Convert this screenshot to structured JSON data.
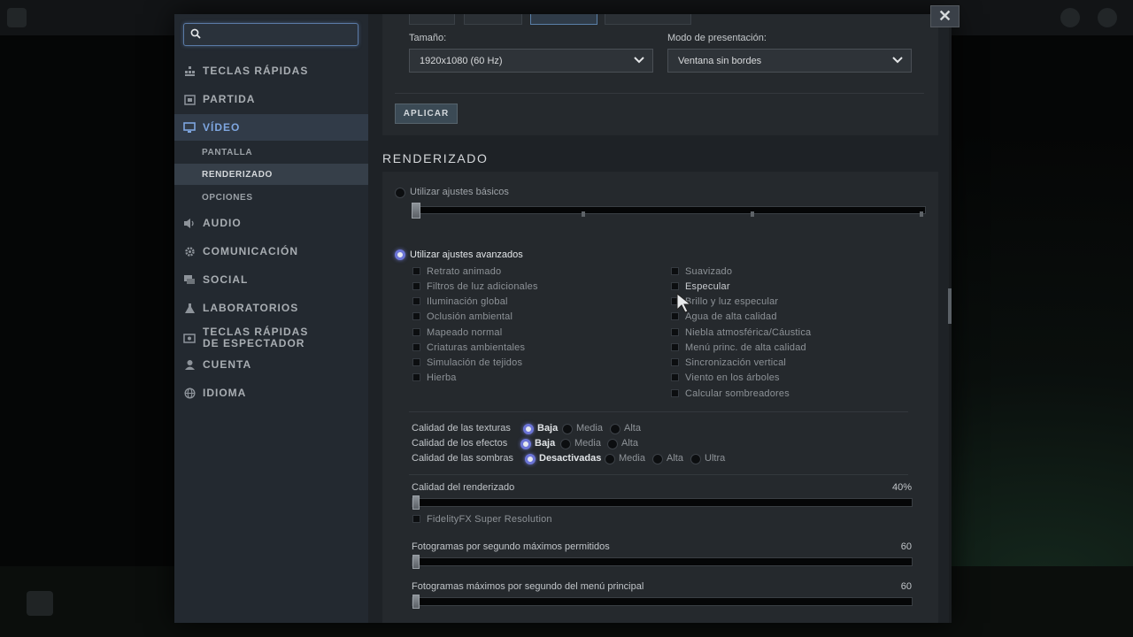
{
  "window": {
    "close_label": "✕"
  },
  "search": {
    "placeholder": "",
    "value": ""
  },
  "sidebar": {
    "items": [
      {
        "id": "hotkeys",
        "label": "TECLAS RÁPIDAS",
        "icon": "grid-icon"
      },
      {
        "id": "game",
        "label": "PARTIDA",
        "icon": "game-icon"
      },
      {
        "id": "video",
        "label": "VÍDEO",
        "icon": "monitor-icon",
        "active": true
      },
      {
        "id": "audio",
        "label": "AUDIO",
        "icon": "speaker-icon"
      },
      {
        "id": "comms",
        "label": "COMUNICACIÓN",
        "icon": "gear-icon"
      },
      {
        "id": "social",
        "label": "SOCIAL",
        "icon": "chat-icon"
      },
      {
        "id": "labs",
        "label": "LABORATORIOS",
        "icon": "flask-icon"
      },
      {
        "id": "spectator",
        "label": "TECLAS RÁPIDAS DE ESPECTADOR",
        "icon": "spectator-icon"
      },
      {
        "id": "account",
        "label": "CUENTA",
        "icon": "user-icon"
      },
      {
        "id": "language",
        "label": "IDIOMA",
        "icon": "globe-icon"
      }
    ],
    "video_sub": [
      {
        "label": "PANTALLA"
      },
      {
        "label": "RENDERIZADO",
        "active": true
      },
      {
        "label": "OPCIONES"
      }
    ]
  },
  "display": {
    "size_label": "Tamaño:",
    "size_value": "1920x1080 (60 Hz)",
    "mode_label": "Modo de presentación:",
    "mode_value": "Ventana sin bordes",
    "apply_label": "APLICAR"
  },
  "render": {
    "title": "RENDERIZADO",
    "basic_label": "Utilizar ajustes básicos",
    "advanced_label": "Utilizar ajustes avanzados",
    "left_options": [
      "Retrato animado",
      "Filtros de luz adicionales",
      "Iluminación global",
      "Oclusión ambiental",
      "Mapeado normal",
      "Criaturas ambientales",
      "Simulación de tejidos",
      "Hierba"
    ],
    "right_options": [
      "Suavizado",
      "Especular",
      "Brillo y luz especular",
      "Agua de alta calidad",
      "Niebla atmosférica/Cáustica",
      "Menú princ. de alta calidad",
      "Sincronización vertical",
      "Viento en los árboles",
      "Calcular sombreadores"
    ],
    "texture_label": "Calidad de las texturas",
    "texture_options": [
      "Baja",
      "Media",
      "Alta"
    ],
    "effects_label": "Calidad de los efectos",
    "effects_options": [
      "Baja",
      "Media",
      "Alta"
    ],
    "shadows_label": "Calidad de las sombras",
    "shadows_options": [
      "Desactivadas",
      "Media",
      "Alta",
      "Ultra"
    ],
    "render_quality_label": "Calidad del renderizado",
    "render_quality_value": "40%",
    "fsr_label": "FidelityFX Super Resolution",
    "fps_label": "Fotogramas por segundo máximos permitidos",
    "fps_value": "60",
    "menu_fps_label": "Fotogramas máximos por segundo del menú principal",
    "menu_fps_value": "60"
  }
}
